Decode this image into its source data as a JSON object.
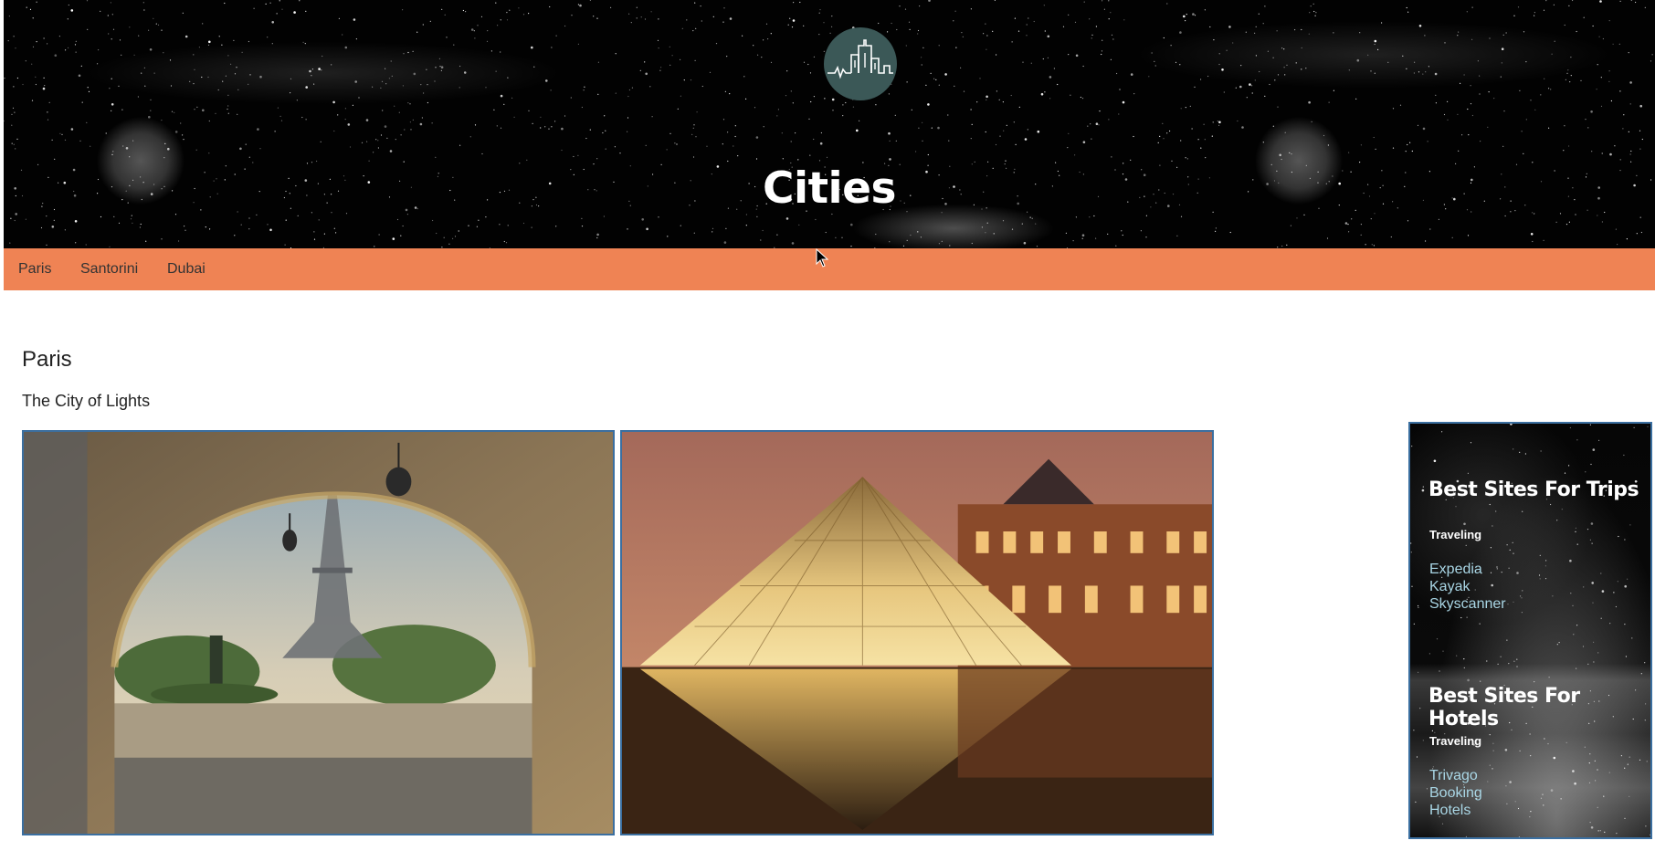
{
  "header": {
    "title": "Cities",
    "logo_icon": "city-skyline-icon"
  },
  "nav": {
    "items": [
      {
        "label": "Paris"
      },
      {
        "label": "Santorini"
      },
      {
        "label": "Dubai"
      }
    ]
  },
  "main": {
    "heading": "Paris",
    "subheading": "The City of Lights",
    "images": [
      {
        "subject": "Eiffel Tower through a stone arch"
      },
      {
        "subject": "Louvre glass pyramid at night"
      }
    ]
  },
  "sidebar": {
    "sections": [
      {
        "heading": "Best Sites For Trips",
        "label": "Traveling",
        "links": [
          "Expedia",
          "Kayak",
          "Skyscanner"
        ]
      },
      {
        "heading": "Best Sites For Hotels",
        "label": "Traveling",
        "links": [
          "Trivago",
          "Booking",
          "Hotels"
        ]
      }
    ]
  },
  "colors": {
    "nav_bg": "#ef8354",
    "logo_bg": "#3b5857",
    "link": "#a9d6e5",
    "image_border": "#3b6fa0"
  }
}
